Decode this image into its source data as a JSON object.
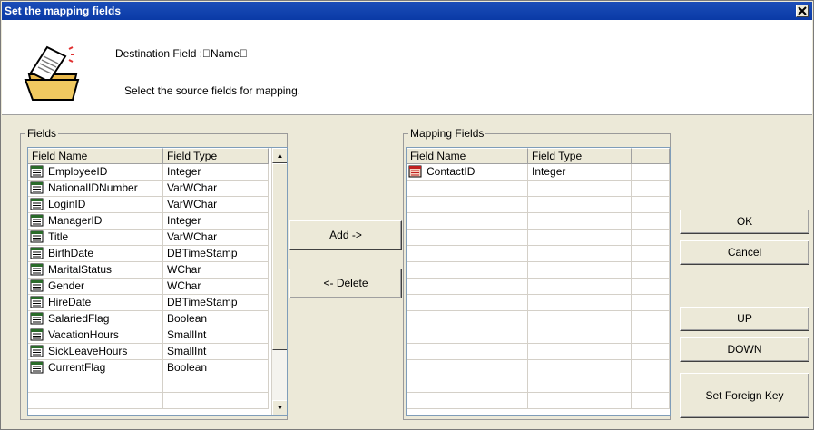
{
  "window": {
    "title": "Set the mapping fields"
  },
  "header": {
    "destination_label": "Destination Field :\u0000Name\u0000",
    "instruction": "Select the source fields for mapping."
  },
  "fields_group": {
    "legend": "Fields",
    "columns": [
      "Field Name",
      "Field Type"
    ],
    "rows": [
      {
        "name": "EmployeeID",
        "type": "Integer"
      },
      {
        "name": "NationalIDNumber",
        "type": "VarWChar"
      },
      {
        "name": "LoginID",
        "type": "VarWChar"
      },
      {
        "name": "ManagerID",
        "type": "Integer"
      },
      {
        "name": "Title",
        "type": "VarWChar"
      },
      {
        "name": "BirthDate",
        "type": "DBTimeStamp"
      },
      {
        "name": "MaritalStatus",
        "type": "WChar"
      },
      {
        "name": "Gender",
        "type": "WChar"
      },
      {
        "name": "HireDate",
        "type": "DBTimeStamp"
      },
      {
        "name": "SalariedFlag",
        "type": "Boolean"
      },
      {
        "name": "VacationHours",
        "type": "SmallInt"
      },
      {
        "name": "SickLeaveHours",
        "type": "SmallInt"
      },
      {
        "name": "CurrentFlag",
        "type": "Boolean"
      }
    ]
  },
  "mapping_group": {
    "legend": "Mapping Fields",
    "columns": [
      "Field Name",
      "Field Type"
    ],
    "rows": [
      {
        "name": "ContactID",
        "type": "Integer"
      }
    ]
  },
  "buttons": {
    "add": "Add ->",
    "delete": "<- Delete",
    "ok": "OK",
    "cancel": "Cancel",
    "up": "UP",
    "down": "DOWN",
    "foreign_key": "Set Foreign Key"
  },
  "icons": {
    "header": "document-folder-icon",
    "field": "field-icon",
    "key_field": "key-field-icon",
    "close": "close-icon"
  }
}
